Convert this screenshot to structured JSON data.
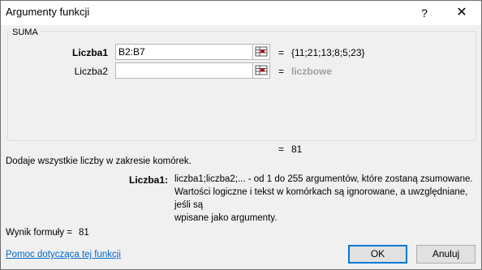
{
  "window": {
    "title": "Argumenty funkcji",
    "help_label": "?",
    "close_label": "✕"
  },
  "function_group": {
    "name": "SUMA"
  },
  "arguments": [
    {
      "label": "Liczba1",
      "value": "B2:B7",
      "eq": "=",
      "result": "{11;21;13;8;5;23}"
    },
    {
      "label": "Liczba2",
      "value": "",
      "eq": "=",
      "result": "liczbowe"
    }
  ],
  "function_result": {
    "eq": "=",
    "value": "81"
  },
  "description": "Dodaje wszystkie liczby w zakresie komórek.",
  "arg_help": {
    "name": "Liczba1:",
    "line1": "liczba1;liczba2;... - od 1 do 255 argumentów, które zostaną zsumowane.",
    "line2": "Wartości logiczne i tekst w komórkach są ignorowane, a uwzględniane, jeśli są",
    "line3": "wpisane jako argumenty."
  },
  "formula_result": {
    "label": "Wynik formuły =",
    "value": "81"
  },
  "help_link": "Pomoc dotycząca tej funkcji",
  "buttons": {
    "ok": "OK",
    "cancel": "Anuluj"
  },
  "icons": {
    "ref": "collapse-range-icon"
  }
}
